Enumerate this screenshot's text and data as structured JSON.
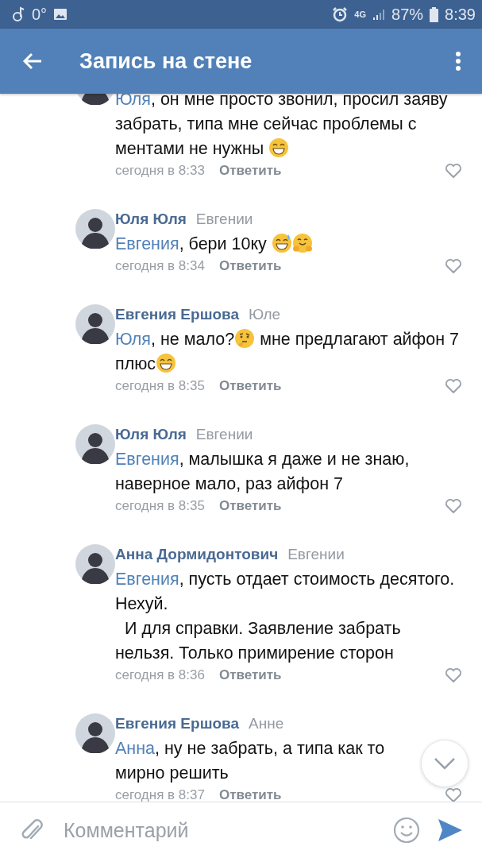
{
  "status_bar": {
    "temperature": "0°",
    "network": "4G",
    "battery": "87%",
    "time": "8:39"
  },
  "header": {
    "title": "Запись на стене"
  },
  "comments": [
    {
      "segments": [
        {
          "kind": "mention",
          "text": "Юля"
        },
        {
          "kind": "text",
          "text": ", он мне просто звонил, просил заяву забрать, типа мне сейчас проблемы с ментами не нужны "
        },
        {
          "kind": "grin_emoji"
        }
      ],
      "time": "сегодня в 8:33",
      "reply": "Ответить"
    },
    {
      "author": "Юля Юля",
      "reply_to": "Евгении",
      "segments": [
        {
          "kind": "mention",
          "text": "Евгения"
        },
        {
          "kind": "text",
          "text": ", бери 10ку "
        },
        {
          "kind": "sweat_emoji"
        },
        {
          "kind": "hug_emoji"
        }
      ],
      "time": "сегодня в 8:34",
      "reply": "Ответить"
    },
    {
      "author": "Евгения Ершова",
      "reply_to": "Юле",
      "segments": [
        {
          "kind": "mention",
          "text": "Юля"
        },
        {
          "kind": "text",
          "text": ", не мало?"
        },
        {
          "kind": "thinking_emoji"
        },
        {
          "kind": "text",
          "text": " мне предлагают айфон 7 плюс"
        },
        {
          "kind": "grin_emoji"
        }
      ],
      "time": "сегодня в 8:35",
      "reply": "Ответить"
    },
    {
      "author": "Юля Юля",
      "reply_to": "Евгении",
      "segments": [
        {
          "kind": "mention",
          "text": "Евгения"
        },
        {
          "kind": "text",
          "text": ", малышка я даже и не знаю, наверное мало, раз айфон 7"
        }
      ],
      "time": "сегодня в 8:35",
      "reply": "Ответить"
    },
    {
      "author": "Анна Дормидонтович",
      "reply_to": "Евгении",
      "segments": [
        {
          "kind": "mention",
          "text": "Евгения"
        },
        {
          "kind": "text",
          "text": ", пусть отдает стоимость десятого. Нехуй.\n  И для справки. Заявление забрать нельзя. Только примирение сторон"
        }
      ],
      "time": "сегодня в 8:36",
      "reply": "Ответить"
    },
    {
      "author": "Евгения Ершова",
      "reply_to": "Анне",
      "segments": [
        {
          "kind": "mention",
          "text": "Анна"
        },
        {
          "kind": "text",
          "text": ", ну не забрать, а типа как то мирно решить"
        }
      ],
      "time": "сегодня в 8:37",
      "reply": "Ответить"
    }
  ],
  "composer": {
    "placeholder": "Комментарий"
  }
}
